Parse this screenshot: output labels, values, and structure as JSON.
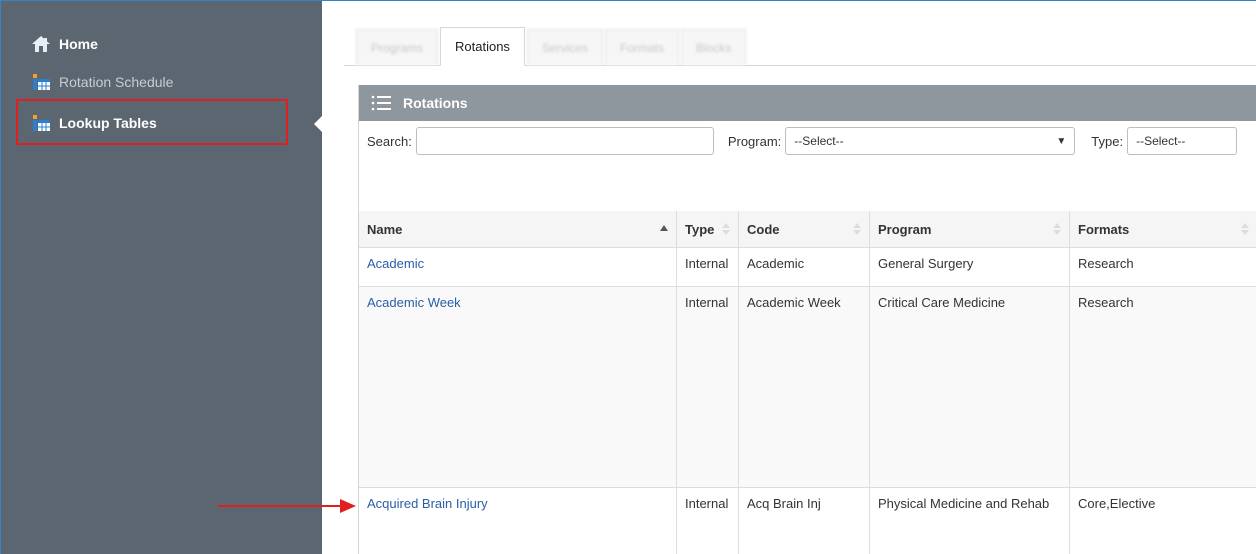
{
  "sidebar": {
    "items": [
      {
        "label": "Home",
        "icon": "home-icon"
      },
      {
        "label": "Rotation Schedule",
        "icon": "schedule-icon"
      },
      {
        "label": "Lookup Tables",
        "icon": "table-icon"
      }
    ]
  },
  "tabs": [
    {
      "label": "Programs",
      "active": false
    },
    {
      "label": "Rotations",
      "active": true
    },
    {
      "label": "Services",
      "active": false
    },
    {
      "label": "Formats",
      "active": false
    },
    {
      "label": "Blocks",
      "active": false
    }
  ],
  "panel": {
    "title": "Rotations",
    "filters": {
      "search_label": "Search:",
      "program_label": "Program:",
      "program_value": "--Select--",
      "type_label": "Type:",
      "type_value": "--Select--"
    }
  },
  "table": {
    "columns": [
      "Name",
      "Type",
      "Code",
      "Program",
      "Formats"
    ],
    "rows": [
      {
        "name": "Academic",
        "type": "Internal",
        "code": "Academic",
        "program": "General Surgery",
        "formats": "Research"
      },
      {
        "name": "Academic Week",
        "type": "Internal",
        "code": "Academic Week",
        "program": "Critical Care Medicine",
        "formats": "Research"
      },
      {
        "name": "Acquired Brain Injury",
        "type": "Internal",
        "code": "Acq Brain Inj",
        "program": "Physical Medicine and Rehab",
        "formats": "Core,Elective"
      }
    ]
  },
  "colors": {
    "sidebar_bg": "#5c6670",
    "panel_header_bg": "#8e979e",
    "link": "#2a5ea8",
    "annotation": "#e02020"
  }
}
